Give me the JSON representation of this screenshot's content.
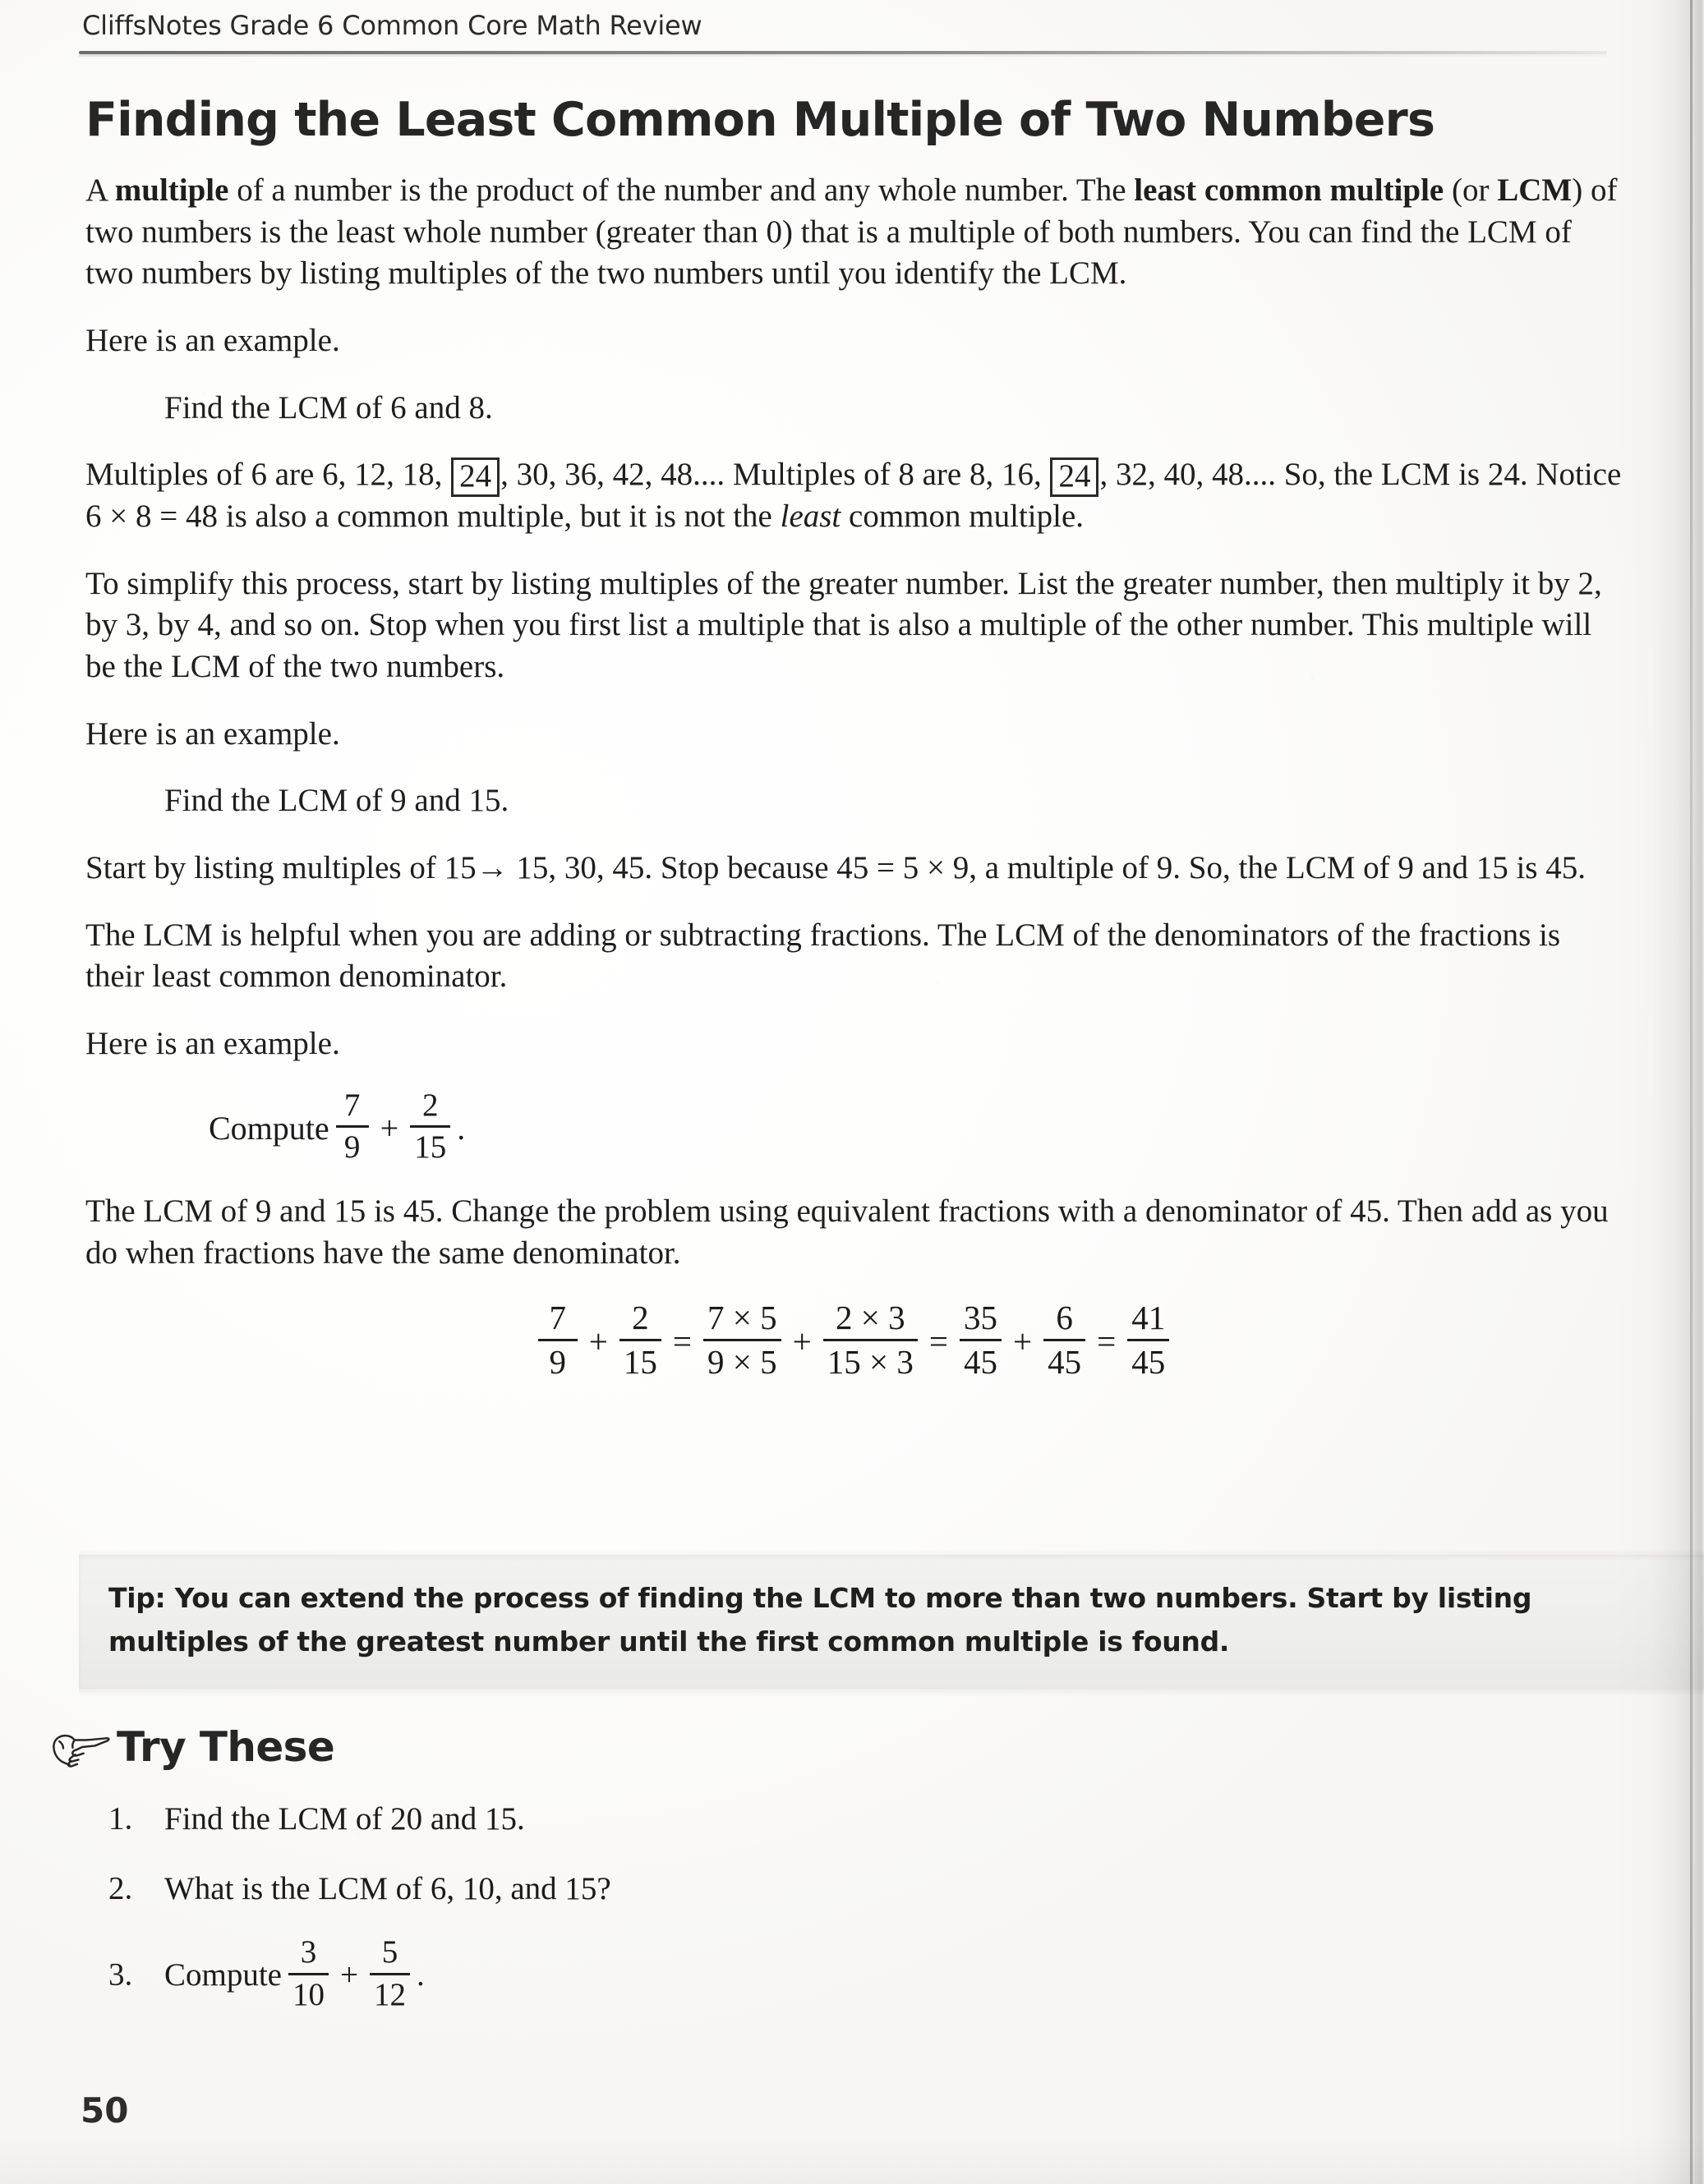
{
  "running_head": "CliffsNotes Grade 6 Common Core Math Review",
  "title": "Finding the Least Common Multiple of Two Numbers",
  "paragraphs": {
    "intro_1": "A ",
    "intro_bold_1": "multiple",
    "intro_2": " of a number is the product of the number and any whole number. The ",
    "intro_bold_2": "least common multiple",
    "intro_3": " (or ",
    "intro_bold_3": "LCM",
    "intro_4": ") of two numbers is the least whole number (greater than 0) that is a multiple of both numbers. You can find the LCM of two numbers by listing multiples of the two numbers until you identify the LCM.",
    "here_example_1": "Here is an example.",
    "find_lcm_6_8": "Find the LCM of 6 and 8.",
    "multiples_a": "Multiples of 6 are 6, 12, 18, ",
    "boxed_1": "24",
    "multiples_b": ", 30, 36, 42, 48.... Multiples of 8 are 8, 16, ",
    "boxed_2": "24",
    "multiples_c": ", 32, 40, 48.... So, the LCM is 24. Notice 6 × 8 = 48 is also a common multiple, but it is not the ",
    "multiples_italic": "least",
    "multiples_d": " common multiple.",
    "simplify": "To simplify this process, start by listing multiples of the greater number. List the greater number, then multiply it by 2, by 3, by 4, and so on. Stop when you first list a multiple that is also a multiple of the other number. This multiple will be the LCM of the two numbers.",
    "here_example_2": "Here is an example.",
    "find_lcm_9_15": "Find the LCM of 9 and 15.",
    "start_listing": "Start by listing multiples of 15→ 15, 30, 45. Stop because 45 = 5 × 9, a multiple of 9. So, the LCM of 9 and 15 is 45.",
    "lcm_helpful": "The LCM is helpful when you are adding or subtracting fractions. The LCM of the denominators of the fractions is their least common denominator.",
    "here_example_3": "Here is an example.",
    "compute_label": "Compute",
    "compute_period": ".",
    "lcm_45": "The LCM of 9 and 15 is 45. Change the problem using equivalent fractions with a denominator of 45. Then add as you do when fractions have the same denominator."
  },
  "compute_example": {
    "f1_num": "7",
    "f1_den": "9",
    "plus": "+",
    "f2_num": "2",
    "f2_den": "15"
  },
  "equation": {
    "f1_num": "7",
    "f1_den": "9",
    "op1": "+",
    "f2_num": "2",
    "f2_den": "15",
    "eq1": "=",
    "f3_num": "7 × 5",
    "f3_den": "9 × 5",
    "op2": "+",
    "f4_num": "2 × 3",
    "f4_den": "15 × 3",
    "eq2": "=",
    "f5_num": "35",
    "f5_den": "45",
    "op3": "+",
    "f6_num": "6",
    "f6_den": "45",
    "eq3": "=",
    "f7_num": "41",
    "f7_den": "45"
  },
  "tip": {
    "text": "Tip: You can extend the process of finding the LCM to more than two numbers. Start by listing multiples of the greatest number until the first common multiple is found."
  },
  "try_these": {
    "heading": "Try These",
    "icon": "pointing-hand-icon",
    "items": [
      {
        "number": "1.",
        "text": "Find the LCM of 20 and 15."
      },
      {
        "number": "2.",
        "text": "What is the LCM of 6, 10, and 15?"
      },
      {
        "number": "3.",
        "text_before": "Compute",
        "f1_num": "3",
        "f1_den": "10",
        "op": "+",
        "f2_num": "5",
        "f2_den": "12",
        "text_after": "."
      }
    ]
  },
  "page_number": "50",
  "colors": {
    "ink": "#1e1e1e",
    "heading": "#262626",
    "tip_background": "#efefee",
    "paper": "#fdfdfc"
  }
}
